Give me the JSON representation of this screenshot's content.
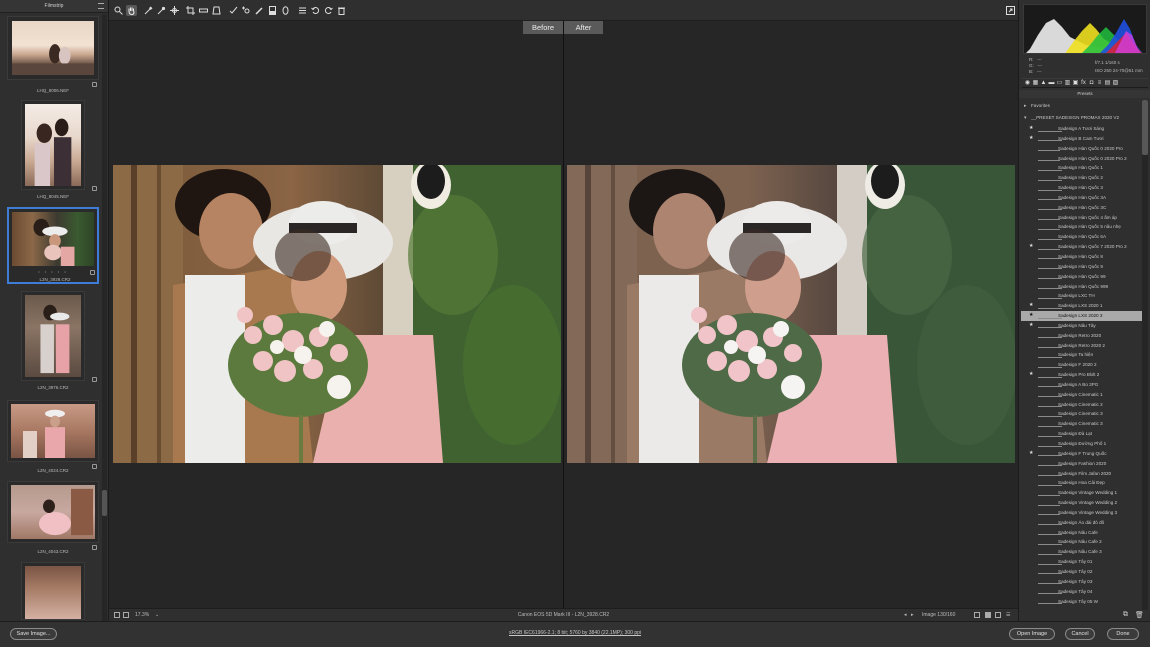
{
  "filmstrip": {
    "title": "Filmstrip",
    "thumbs": [
      {
        "name": "LHQ_8006.NEF"
      },
      {
        "name": "LHQ_8045.NEF"
      },
      {
        "name": "L2N_3928.CR2",
        "stars": "• • • • •"
      },
      {
        "name": "L2N_3976.CR2"
      },
      {
        "name": "L2N_4024.CR2"
      },
      {
        "name": "L2N_4043.CR2"
      },
      {
        "name": ""
      }
    ]
  },
  "preview": {
    "before_label": "Before",
    "after_label": "After"
  },
  "status": {
    "zoom": "17.3%",
    "camera_file": "Canon EOS 5D Mark III  -  L2N_3928.CR2",
    "image_counter": "Image 130/160"
  },
  "histogram": {
    "r": "R:",
    "g": "G:",
    "b": "B:",
    "dash": "---",
    "aperture_shutter": "f/7.1     1/160 s",
    "iso_lens": "ISO 250    24-70@51 mm"
  },
  "presets": {
    "title": "Presets",
    "favorites": "Favorites",
    "group": "__PRESET SADESIGN PROMAX 2020 V2",
    "items": [
      {
        "label": "Sadesign A Tươi Sáng",
        "star": true
      },
      {
        "label": "Sadesign B  Cam Tươi",
        "star": true
      },
      {
        "label": "Sadesign Hàn Quốc 0 2020 Pro",
        "star": false
      },
      {
        "label": "Sadesign Hàn Quốc 0 2020 Pro 2",
        "star": false
      },
      {
        "label": "Sadesign Hàn Quốc 1",
        "star": false
      },
      {
        "label": "Sadesign Hàn Quốc 2",
        "star": false
      },
      {
        "label": "Sadesign Hàn Quốc 3",
        "star": false
      },
      {
        "label": "Sadesign Hàn Quốc 3A",
        "star": false
      },
      {
        "label": "Sadesign Hàn Quốc 3C",
        "star": false
      },
      {
        "label": "Sadesign Hàn Quốc 4 ấm áp",
        "star": false
      },
      {
        "label": "Sadesign Hàn Quốc 5 nâu nhẹ",
        "star": false
      },
      {
        "label": "Sadesign Hàn Quốc 6A",
        "star": false
      },
      {
        "label": "Sadesign Hàn Quốc 7 2020 Pro 2",
        "star": true
      },
      {
        "label": "Sadesign Hàn Quốc 8",
        "star": false
      },
      {
        "label": "Sadesign Hàn Quốc 9",
        "star": false
      },
      {
        "label": "Sadesign Hàn Quốc 99",
        "star": false
      },
      {
        "label": "Sadesign Hàn Quốc 999",
        "star": false
      },
      {
        "label": "Sadesign LXC  TH",
        "star": false
      },
      {
        "label": "Sadesign LXS 2020 1",
        "star": true
      },
      {
        "label": "Sadesign LXS 2020 3",
        "star": true,
        "selected": true
      },
      {
        "label": "Sadesign Nâu Tây",
        "star": true
      },
      {
        "label": "Sadesign Retro 2020",
        "star": false
      },
      {
        "label": "Sadesign Retro 2020 2",
        "star": false
      },
      {
        "label": "Sadesign Ta hiện",
        "star": false
      },
      {
        "label": "Sadesign  F 2020 2",
        "star": false
      },
      {
        "label": "Sadesign  Pro Blxlt 2",
        "star": true
      },
      {
        "label": "Sadesign A Bo 3PG",
        "star": false
      },
      {
        "label": "Sadesign Cinematic 1",
        "star": false
      },
      {
        "label": "Sadesign Cinematic 2",
        "star": false
      },
      {
        "label": "Sadesign Cinematic 3",
        "star": false
      },
      {
        "label": "Sadesign Cinematic 3",
        "star": false
      },
      {
        "label": "Sadesign Đà Lạt",
        "star": false
      },
      {
        "label": "Sadesign Đường Phố 1",
        "star": false
      },
      {
        "label": "Sadesign F Trung Quốc",
        "star": true
      },
      {
        "label": "Sadesign Fashion 2020",
        "star": false
      },
      {
        "label": "Sadesign Film Jafan 2020",
        "star": false
      },
      {
        "label": "Sadesign Hoa Cải Đẹp",
        "star": false
      },
      {
        "label": "Sadesign Vintage Wedding 1",
        "star": false
      },
      {
        "label": "Sadesign Vintage Wedding 2",
        "star": false
      },
      {
        "label": "Sadesign Vintage Wedding 3",
        "star": false
      },
      {
        "label": "Sadesign Áo dài đỏ đô",
        "star": false
      },
      {
        "label": "Sadesign Nâu Cafe",
        "star": false
      },
      {
        "label": "Sadesign Nâu Cafe 2",
        "star": false
      },
      {
        "label": "Sadesign Nâu Cafe 3",
        "star": false
      },
      {
        "label": "Sadesign Tây 01",
        "star": false
      },
      {
        "label": "Sadesign Tây 02",
        "star": false
      },
      {
        "label": "Sadesign Tây 03",
        "star": false
      },
      {
        "label": "Sadesign Tây 04",
        "star": false
      },
      {
        "label": "Sadesign Tây 05 W",
        "star": false
      }
    ]
  },
  "bottom": {
    "save_image": "Save Image...",
    "workflow": "sRGB IEC61966-2.1; 8 bit; 5760 by 3840 (22.1MP); 300 ppi",
    "open_image": "Open Image",
    "cancel": "Cancel",
    "done": "Done"
  },
  "icons": {
    "zoom": "zoom-icon",
    "hand": "hand-icon",
    "white_balance": "white-balance-icon",
    "color_sampler": "color-sampler-icon",
    "targeted_adjust": "targeted-adjustment-icon",
    "crop": "crop-icon",
    "straighten": "straighten-icon",
    "transform": "transform-icon",
    "spot_removal": "spot-removal-icon",
    "red_eye": "red-eye-icon",
    "adjustment_brush": "adjustment-brush-icon",
    "graduated_filter": "graduated-filter-icon",
    "radial_filter": "radial-filter-icon",
    "preferences": "preferences-icon",
    "rotate_ccw": "rotate-ccw-icon",
    "rotate_cw": "rotate-cw-icon",
    "trash": "trash-icon",
    "fullscreen": "fullscreen-icon"
  },
  "colors": {
    "selection": "#3f7cd6",
    "panel": "#2f2f2f",
    "background": "#262626"
  }
}
